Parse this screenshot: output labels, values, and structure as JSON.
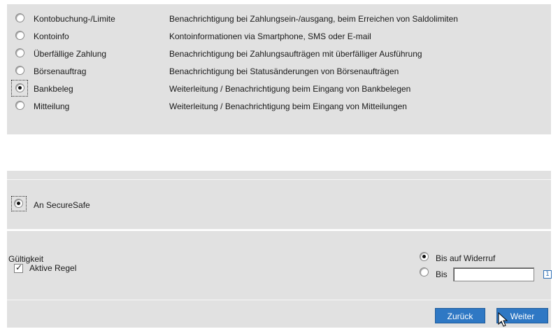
{
  "options": [
    {
      "name": "Kontobuchung-/Limite",
      "description": "Benachrichtigung bei Zahlungsein-/ausgang, beim Erreichen von Saldolimiten",
      "selected": false
    },
    {
      "name": "Kontoinfo",
      "description": "Kontoinformationen via Smartphone, SMS oder E-mail",
      "selected": false
    },
    {
      "name": "Überfällige Zahlung",
      "description": "Benachrichtigung bei Zahlungsaufträgen mit überfälliger Ausführung",
      "selected": false
    },
    {
      "name": "Börsenauftrag",
      "description": "Benachrichtigung bei Statusänderungen von Börsenaufträgen",
      "selected": false
    },
    {
      "name": "Bankbeleg",
      "description": "Weiterleitung / Benachrichtigung beim Eingang von Bankbelegen",
      "selected": true
    },
    {
      "name": "Mitteilung",
      "description": "Weiterleitung / Benachrichtigung beim Eingang von Mitteilungen",
      "selected": false
    }
  ],
  "destination": {
    "label": "An SecureSafe",
    "selected": true
  },
  "validity": {
    "title": "Gültigkeit",
    "active_rule_label": "Aktive Regel",
    "active_rule_checked": true,
    "until_revoked_label": "Bis auf Widerruf",
    "until_revoked_selected": true,
    "until_label": "Bis",
    "until_value": "",
    "calendar_icon": "calendar-icon"
  },
  "buttons": {
    "back": "Zurück",
    "next": "Weiter"
  },
  "colors": {
    "panel": "#e1e1e1",
    "button": "#2f78c4"
  }
}
